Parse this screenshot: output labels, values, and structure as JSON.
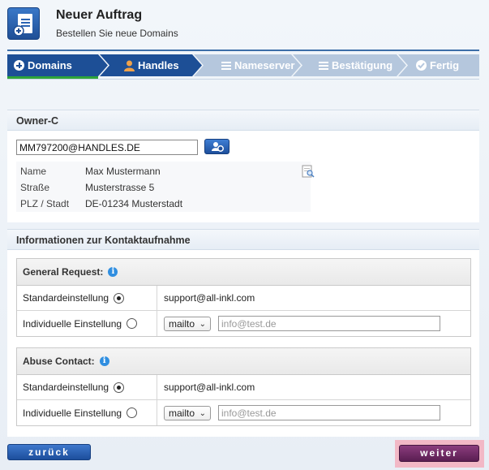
{
  "header": {
    "title": "Neuer Auftrag",
    "subtitle": "Bestellen Sie neue Domains"
  },
  "steps": [
    {
      "label": "Domains",
      "icon": "plus-circle-icon",
      "active": true
    },
    {
      "label": "Handles",
      "icon": "person-icon",
      "active": true
    },
    {
      "label": "Nameserver",
      "icon": "list-icon",
      "active": false
    },
    {
      "label": "Bestätigung",
      "icon": "list-icon",
      "active": false
    },
    {
      "label": "Fertig",
      "icon": "check-circle-icon",
      "active": false
    }
  ],
  "colors": {
    "step_active": "#1d4f96",
    "step_inactive": "#b5c7dd",
    "progress_green": "#2ea43a",
    "back_button": "#2a62b4",
    "next_button": "#6f2b65",
    "next_highlight": "#f2b8c6"
  },
  "owner": {
    "section_title": "Owner-C",
    "handle_value": "MM797200@HANDLES.DE",
    "labels": {
      "name": "Name",
      "street": "Straße",
      "zip_city": "PLZ / Stadt"
    },
    "values": {
      "name": "Max Mustermann",
      "street": "Musterstrasse 5",
      "zip_city": "DE-01234 Musterstadt"
    }
  },
  "contact": {
    "section_title": "Informationen zur Kontaktaufnahme",
    "general": {
      "title": "General Request:",
      "default_label": "Standardeinstellung",
      "default_value": "support@all-inkl.com",
      "custom_label": "Individuelle Einstellung",
      "protocol": "mailto",
      "placeholder": "info@test.de"
    },
    "abuse": {
      "title": "Abuse Contact:",
      "default_label": "Standardeinstellung",
      "default_value": "support@all-inkl.com",
      "custom_label": "Individuelle Einstellung",
      "protocol": "mailto",
      "placeholder": "info@test.de"
    }
  },
  "buttons": {
    "back": "zurück",
    "next": "weiter"
  }
}
